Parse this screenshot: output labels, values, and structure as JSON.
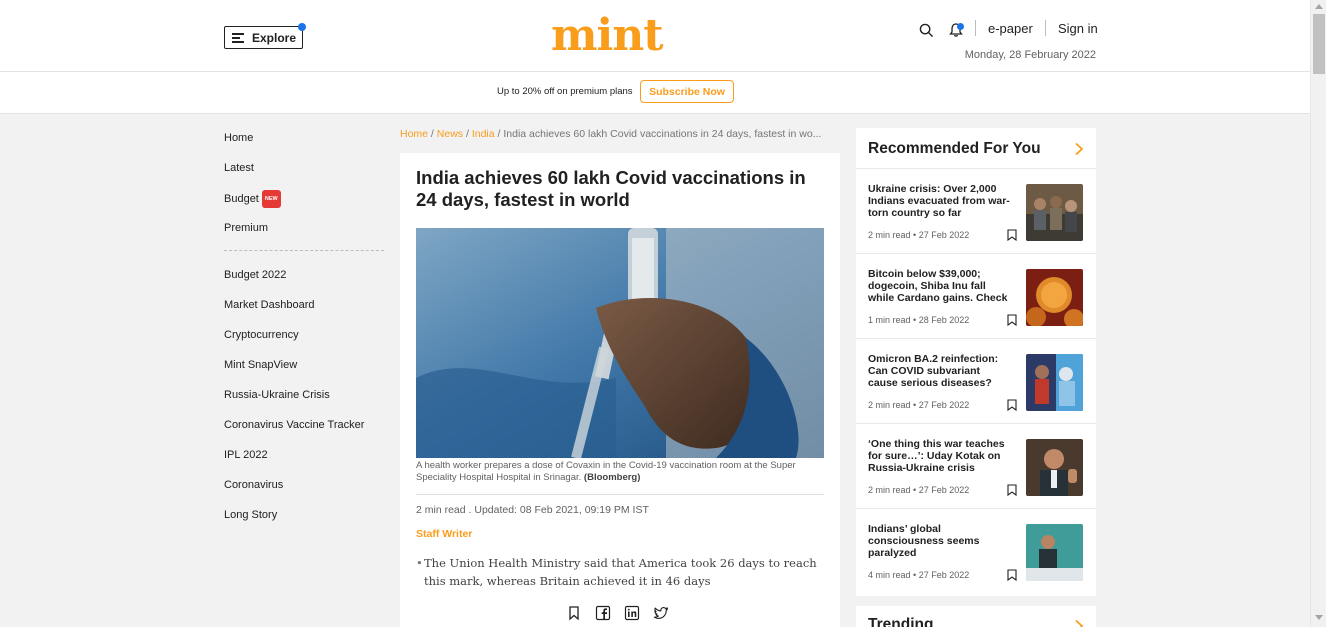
{
  "header": {
    "explore_label": "Explore",
    "logo_text": "mint",
    "epaper_label": "e-paper",
    "signin_label": "Sign in",
    "date": "Monday, 28 February 2022",
    "brand_color": "#f99d1c"
  },
  "promo": {
    "text": "Up to 20% off on premium plans",
    "subscribe_label": "Subscribe Now"
  },
  "leftnav": {
    "primary": [
      {
        "label": "Home"
      },
      {
        "label": "Latest"
      },
      {
        "label": "Budget",
        "badge": "NEW"
      },
      {
        "label": "Premium"
      }
    ],
    "secondary": [
      {
        "label": "Budget 2022"
      },
      {
        "label": "Market Dashboard"
      },
      {
        "label": "Cryptocurrency"
      },
      {
        "label": "Mint SnapView"
      },
      {
        "label": "Russia-Ukraine Crisis"
      },
      {
        "label": "Coronavirus Vaccine Tracker"
      },
      {
        "label": "IPL 2022"
      },
      {
        "label": "Coronavirus"
      },
      {
        "label": "Long Story"
      }
    ]
  },
  "breadcrumb": {
    "items": [
      "Home",
      "News",
      "India"
    ],
    "current": "India achieves 60 lakh Covid vaccinations in 24 days, fastest in wo..."
  },
  "article": {
    "headline": "India achieves 60 lakh Covid vaccinations in 24 days, fastest in world",
    "caption": "A health worker prepares a dose of Covaxin in the Covid-19 vaccination room at the Super Speciality Hospital Hospital in Srinagar.",
    "caption_credit": "(Bloomberg)",
    "read_meta": "2 min read . Updated: 08 Feb 2021, 09:19 PM IST",
    "author": "Staff Writer",
    "summary": "The Union Health Ministry said that America took 26 days to reach this mark, whereas Britain achieved it in 46 days",
    "share_icons": [
      "bookmark-icon",
      "facebook-icon",
      "linkedin-icon",
      "twitter-icon"
    ]
  },
  "recommended": {
    "title": "Recommended For You",
    "items": [
      {
        "title": "Ukraine crisis: Over 2,000 Indians evacuated from war-torn country so far",
        "read": "2 min read",
        "date": "27 Feb 2022"
      },
      {
        "title": "Bitcoin below $39,000; dogecoin, Shiba Inu fall while Cardano gains. Check cryptocurrency prices",
        "read": "1 min read",
        "date": "28 Feb 2022"
      },
      {
        "title": "Omicron BA.2 reinfection: Can COVID subvariant cause serious diseases? Experts explain severity",
        "read": "2 min read",
        "date": "27 Feb 2022"
      },
      {
        "title": "‘One thing this war teaches for sure…’: Uday Kotak on Russia-Ukraine crisis",
        "read": "2 min read",
        "date": "27 Feb 2022"
      },
      {
        "title": "Indians’ global consciousness seems paralyzed",
        "read": "4 min read",
        "date": "27 Feb 2022"
      }
    ]
  },
  "trending": {
    "title": "Trending"
  }
}
